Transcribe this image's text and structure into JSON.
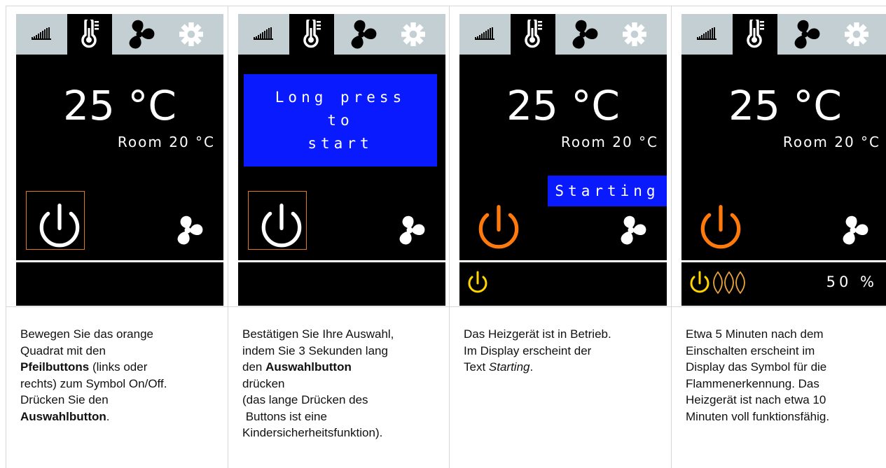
{
  "panels": [
    {
      "big_temp": "25 °C",
      "room": "Room  20 °C",
      "caption": [
        "Bewegen Sie das orange",
        "Quadrat mit den",
        "",
        " (links oder",
        "rechts) zum Symbol On/Off.",
        "Drücken Sie den",
        "",
        "."
      ],
      "bold": [
        "Pfeilbuttons",
        "Auswahlbutton"
      ]
    },
    {
      "message": [
        "Long press",
        "to",
        "start"
      ],
      "caption": [
        "Bestätigen Sie Ihre Auswahl,",
        "indem Sie 3 Sekunden lang",
        "den ",
        "",
        "drücken",
        "(das lange Drücken des",
        " Buttons ist eine",
        "Kindersicherheitsfunktion)."
      ],
      "bold": [
        "Auswahlbutton"
      ]
    },
    {
      "big_temp": "25 °C",
      "room": "Room  20 °C",
      "status_label": "Starting",
      "caption": [
        "Das Heizgerät ist in Betrieb.",
        "Im Display erscheint der",
        "Text ",
        "."
      ],
      "italic": [
        "Starting"
      ]
    },
    {
      "big_temp": "25 °C",
      "room": "Room  20 °C",
      "power_percent": "50 %",
      "caption": [
        "Etwa 5 Minuten nach dem",
        "Einschalten erscheint im",
        "Display das Symbol für die",
        "Flammenerkennung. Das",
        "Heizgerät ist nach etwa 10",
        "Minuten voll funktionsfähig."
      ]
    }
  ],
  "icons": [
    "signal-bars-icon",
    "thermometer-icon",
    "fan-icon",
    "gear-icon",
    "power-icon",
    "flame-icon"
  ],
  "colors": {
    "tabbar": "#c4cfd4",
    "screen": "#000000",
    "message_blue": "#0a1aff",
    "power_orange": "#ff7a0a",
    "power_yellow": "#ffd400",
    "selection_border": "#e07a16"
  }
}
